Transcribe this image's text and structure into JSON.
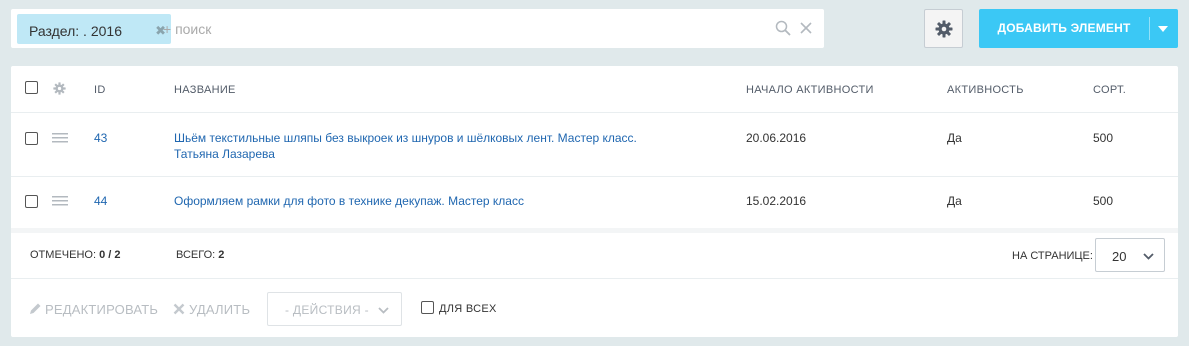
{
  "search": {
    "filter_chip_label": "Раздел: . 2016",
    "placeholder": "+ поиск"
  },
  "toolbar": {
    "add_button_label": "ДОБАВИТЬ ЭЛЕМЕНТ"
  },
  "grid": {
    "columns": {
      "id": "ID",
      "name": "НАЗВАНИЕ",
      "active_from": "НАЧАЛО АКТИВНОСТИ",
      "active": "АКТИВНОСТЬ",
      "sort": "СОРТ."
    },
    "rows": [
      {
        "id": "43",
        "name_line1": "Шьём текстильные шляпы без выкроек из шнуров и шёлковых лент. Мастер класс.",
        "name_line2": "Татьяна Лазарева",
        "active_from": "20.06.2016",
        "active": "Да",
        "sort": "500"
      },
      {
        "id": "44",
        "name_line1": "Оформляем рамки для фото в технике декупаж. Мастер класс",
        "name_line2": "",
        "active_from": "15.02.2016",
        "active": "Да",
        "sort": "500"
      }
    ]
  },
  "footer": {
    "checked_label": "ОТМЕЧЕНО:",
    "checked_value": "0 / 2",
    "total_label": "ВСЕГО:",
    "total_value": "2",
    "per_page_label": "НА СТРАНИЦЕ:",
    "per_page_value": "20"
  },
  "actions": {
    "edit_label": "РЕДАКТИРОВАТЬ",
    "delete_label": "УДАЛИТЬ",
    "actions_select_label": "- ДЕЙСТВИЯ -",
    "for_all_label": "ДЛЯ ВСЕХ"
  },
  "colors": {
    "background": "#e0e9eb",
    "accent": "#3bc8f5",
    "chip": "#bfe8f6",
    "link": "#2067b0"
  }
}
